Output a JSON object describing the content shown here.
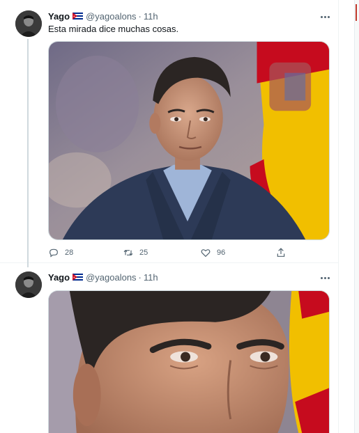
{
  "tweets": [
    {
      "author_name": "Yago",
      "handle": "@yagoalons",
      "separator": "·",
      "time": "11h",
      "text": "Esta mirada dice muchas cosas.",
      "media_alt": "Man in navy suit and light blue shirt in front of a Spanish flag",
      "actions": {
        "replies": "28",
        "retweets": "25",
        "likes": "96"
      }
    },
    {
      "author_name": "Yago",
      "handle": "@yagoalons",
      "separator": "·",
      "time": "11h",
      "media_alt": "Close-up crop of the man's face and eyes"
    }
  ],
  "icons": {
    "flag": "cuba-flag-icon",
    "more": "more-horizontal-icon",
    "reply": "reply-icon",
    "retweet": "retweet-icon",
    "like": "heart-icon",
    "share": "share-icon"
  },
  "colors": {
    "text": "#0f1419",
    "secondary": "#536471",
    "border": "#cfd9de",
    "flag_blue": "#002a8f",
    "flag_red": "#cf142b"
  }
}
